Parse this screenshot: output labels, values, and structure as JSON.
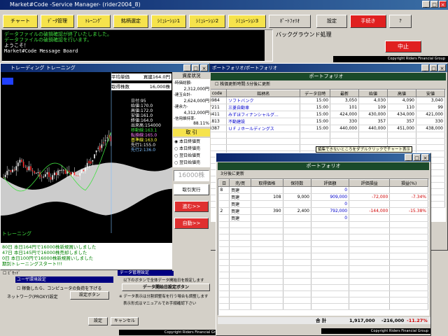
{
  "main_window": {
    "title": "Market#Code -Service Manager-  (rider2004_8)",
    "toolbar": [
      {
        "label": "チャート",
        "style": "yel"
      },
      {
        "label": "ﾃﾞｰﾀ管理",
        "style": "yel"
      },
      {
        "label": "ﾄﾚｰﾆﾝｸﾞ",
        "style": "yel"
      },
      {
        "label": "銘柄選定",
        "style": "yel"
      },
      {
        "label": "ｼﾐｭﾚｰｼｮﾝ1",
        "style": "yel"
      },
      {
        "label": "ｼﾐｭﾚｰｼｮﾝ2",
        "style": "yel"
      },
      {
        "label": "ｼﾐｭﾚｰｼｮﾝ3",
        "style": "yel"
      },
      {
        "label": "ﾎﾟｰﾄﾌｫﾘｵ",
        "style": "plain"
      },
      {
        "label": "設定",
        "style": "plain"
      },
      {
        "label": "手続き",
        "style": "red"
      },
      {
        "label": "?",
        "style": "plain"
      }
    ],
    "messages": [
      "データファイルの破損確認が終了いたしました。",
      "データファイルの破損確認を行います。",
      "ようこそ！",
      "Market#Code Message Board"
    ],
    "bg_process_label": "バックグラウンド処理",
    "stop_button": "中止",
    "copyright": "Copyright Riders Financial Group"
  },
  "training_window": {
    "title": "トレーディング トレーニング",
    "avg_price_label": "平均単価",
    "avg_price_value": "買建164.0円",
    "shares_label": "取得株数",
    "shares_value": "16,000株",
    "asset_status_title": "資産状況",
    "assets": [
      {
        "label": "-時価総額-",
        "value": "2,312,000円"
      },
      {
        "label": "-建玉合計-",
        "value": "2,624,000円"
      },
      {
        "label": "-建余力-",
        "value": "4,312,000円"
      },
      {
        "label": "-信用維持率-",
        "value": "88.11%"
      }
    ],
    "chart_info": [
      "日付:95",
      "始値:170.0",
      "高値:172.0",
      "安値:161.0",
      "終値:164.0",
      "出来高:154000"
    ],
    "chart_info_green": [
      "移動線:163.1"
    ],
    "chart_info_lines": [
      "転換線:165.0",
      "基準線:163.0",
      "先行1:155.0",
      "先行2:136.0"
    ],
    "chart_bottom_left": "トレーニング",
    "trade_header": "取 引",
    "radio_options": [
      "本日終値買",
      "本日終値売",
      "翌日始値買",
      "翌日始値売"
    ],
    "qty": "16000株",
    "execute_button": "取引実行",
    "next_button": "進む>>",
    "auto_button": "自動>>",
    "log": [
      "80日 本日164円で16000株新規買いしました",
      "47日 本日145円で16000株売却しました",
      "0日 本日100円で16000株新規買いしました",
      "期別トレーニングスタート!!!"
    ]
  },
  "portfolio_list_window": {
    "title": "ポートフォリオ/ポートフォリオ",
    "header": "ポートフォリオ",
    "auto_update_label": "株価更新時間:5分後に更新",
    "columns": [
      "code",
      "銘柄名",
      "データ日時",
      "最新",
      "始値",
      "高値",
      "安値"
    ],
    "rows": [
      [
        "8984",
        "ソフトバンク",
        "15:00",
        "3,050",
        "4,030",
        "4,090",
        "3,040"
      ],
      [
        "7211",
        "三菱自動車",
        "15:00",
        "101",
        "109",
        "110",
        "99"
      ],
      [
        "8411",
        "みずほフィナンシャルグ...",
        "15:00",
        "424,000",
        "430,000",
        "434,000",
        "421,000"
      ],
      [
        "1813",
        "不動建設",
        "15:00",
        "330",
        "357",
        "357",
        "330"
      ],
      [
        "8387",
        "ＵＦＪホールディングス",
        "15:00",
        "440,000",
        "440,000",
        "451,000",
        "438,000"
      ]
    ],
    "tooltip": "編集できないところをダブルクリックでチャート表示"
  },
  "portfolio_detail_window": {
    "header": "ポートフォリオ",
    "update_label": "3分後に更新",
    "columns": [
      "日",
      "売/買",
      "取得価格",
      "保持数",
      "評価額",
      "評価損益",
      "損益(%)"
    ],
    "rows": [
      [
        "8",
        "買建",
        "",
        "",
        "0",
        "",
        ""
      ],
      [
        "",
        "買建",
        "108",
        "9,000",
        "909,000",
        "-72,000",
        "-7.34%"
      ],
      [
        "",
        "買建",
        "",
        "",
        "0",
        "",
        ""
      ],
      [
        "2",
        "買建",
        "390",
        "2,400",
        "792,000",
        "-144,000",
        "-15.38%"
      ],
      [
        "",
        "買建",
        "",
        "",
        "0",
        "",
        ""
      ]
    ],
    "total_label": "合 計",
    "total_value": "1,917,000",
    "total_pl": "-216,000",
    "total_pct": "-11.27%",
    "copyright": "Copyright Riders Financial Group"
  },
  "settings_window": {
    "title": "データ管理設定",
    "checkbox_top": "ﾋﾞｾｯﾄﾞ",
    "user_env": "ユーザ環境設定",
    "low_priority": "稼働したら、コンピュータの負荷を下げる",
    "network_label": "ネットワーク(PROXY)設定",
    "network_button": "設定ボタン",
    "right_lines": [
      "以下のボタンで全体データ開始日を設定します",
      "データ開始日設定ボタン",
      "※ データ表示は分割調整有を行う場合も調整します",
      "表示形式はマニュアルでお手順確認下さい"
    ],
    "ok_button": "設定",
    "cancel_button": "キャンセル",
    "copyright": "Copyright Riders Financial Group"
  }
}
